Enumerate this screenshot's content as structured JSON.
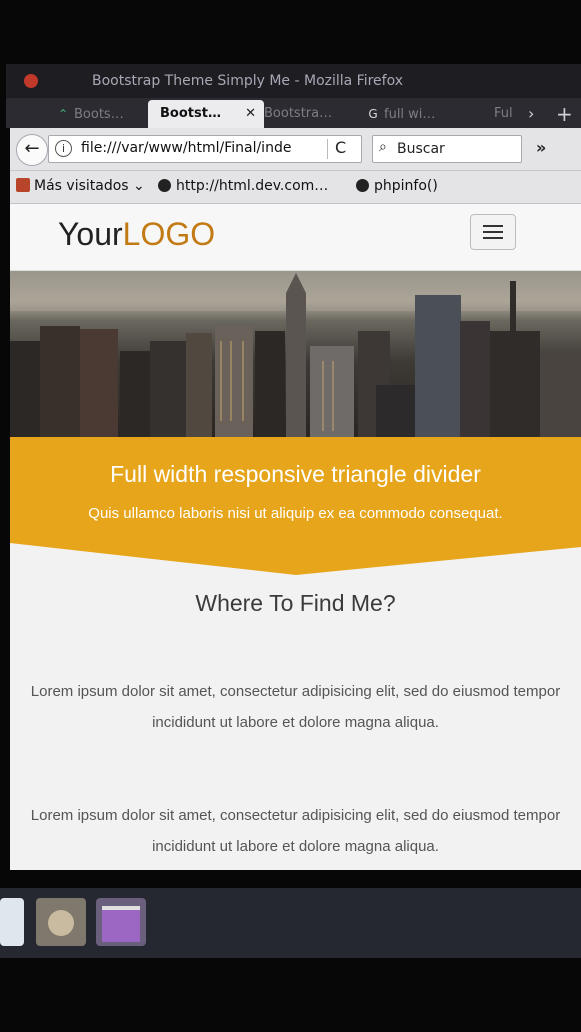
{
  "window": {
    "title": "Bootstrap Theme Simply Me - Mozilla Firefox"
  },
  "tabs": [
    {
      "label": "Boots…",
      "icon": "vue-icon",
      "active": false
    },
    {
      "label": "Bootst…",
      "icon": "none",
      "active": true
    },
    {
      "label": "Bootstra…",
      "icon": "none",
      "active": false
    },
    {
      "label": "full wi…",
      "icon": "google-icon",
      "active": false
    },
    {
      "label": "Ful",
      "icon": "none",
      "active": false
    }
  ],
  "tab_controls": {
    "scroll_right": "›",
    "new_tab": "+"
  },
  "navbar": {
    "back": "←",
    "url": "file:///var/www/html/Final/inde",
    "search_placeholder": "Buscar",
    "overflow": "»",
    "reload": "C"
  },
  "bookmarks": [
    {
      "label": "Más visitados",
      "icon": "folder-icon"
    },
    {
      "label": "http://html.dev.com…",
      "icon": "globe-icon"
    },
    {
      "label": "phpinfo()",
      "icon": "globe-icon"
    }
  ],
  "site": {
    "logo_part1": "Your",
    "logo_part2": "LOGO",
    "banner_title": "Full width responsive triangle divider",
    "banner_subtitle": "Quis ullamco laboris nisi ut aliquip ex ea commodo consequat.",
    "section_heading": "Where To Find Me?",
    "paragraph1": "Lorem ipsum dolor sit amet, consectetur adipisicing elit, sed do eiusmod tempor incididunt ut labore et dolore magna aliqua.",
    "paragraph2": "Lorem ipsum dolor sit amet, consectetur adipisicing elit, sed do eiusmod tempor incididunt ut labore et dolore magna aliqua."
  },
  "colors": {
    "accent": "#e6a51a",
    "logo_accent": "#c27a14"
  },
  "taskbar": [
    {
      "app": "document-icon"
    },
    {
      "app": "gimp-icon"
    },
    {
      "app": "terminal-icon"
    }
  ]
}
